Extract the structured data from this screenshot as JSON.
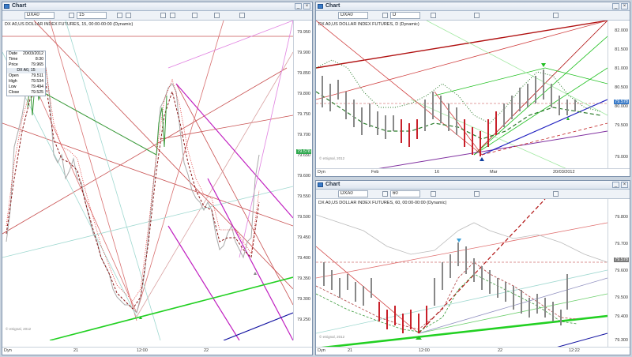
{
  "colors": {
    "accent": "#3a7bc8",
    "price_marker": "#2ea84e",
    "up_bar": "#3a9a3a",
    "down_bar": "#c8202a",
    "neutral_bar": "#888888"
  },
  "left": {
    "title": "Chart",
    "symbol": "DXA0",
    "interval": "15",
    "subtitle": "DX A0,US DOLLAR INDEX FUTURES, 15, 00:00-00:00 (Dynamic)",
    "info": [
      {
        "k": "Date",
        "v": "20/03/2012"
      },
      {
        "k": "Time",
        "v": "8:30"
      },
      {
        "k": "Price",
        "v": "79.965"
      }
    ],
    "info_header": "DX A0, 15",
    "ohlc": [
      {
        "k": "Open",
        "v": "79.511"
      },
      {
        "k": "High",
        "v": "79.534"
      },
      {
        "k": "Low",
        "v": "79.494"
      },
      {
        "k": "Close",
        "v": "79.525"
      }
    ],
    "y_ticks": [
      "79.950",
      "79.900",
      "79.850",
      "79.800",
      "79.750",
      "79.700",
      "79.650",
      "79.600",
      "79.550",
      "79.500",
      "79.450",
      "79.400",
      "79.350",
      "79.300",
      "79.250"
    ],
    "last_price": "79.578",
    "x_ticks": [
      "21",
      "12:00",
      "22"
    ],
    "dyn": "Dyn",
    "copyright": "© eSignal, 2012"
  },
  "top_right": {
    "title": "Chart",
    "symbol": "DXA0",
    "interval": "D",
    "subtitle": "DX A0,US DOLLAR INDEX FUTURES, D (Dynamic)",
    "y_ticks": [
      "82.000",
      "81.500",
      "81.000",
      "80.500",
      "80.000",
      "79.500",
      "79.000"
    ],
    "last_price": "79.578",
    "x_ticks": [
      "Feb",
      "16",
      "Mar"
    ],
    "x_date": "20/03/2012",
    "dyn": "Dyn",
    "copyright": "© eSignal, 2012"
  },
  "bottom_right": {
    "title": "Chart",
    "symbol": "DXA0",
    "interval": "60",
    "subtitle": "DX A0,US DOLLAR INDEX FUTURES, 60, 00:00-00:00 (Dynamic)",
    "y_ticks": [
      "79.800",
      "79.700",
      "79.600",
      "79.500",
      "79.400",
      "79.300"
    ],
    "last_price": "79.578",
    "x_ticks": [
      "21",
      "12:00",
      "22",
      "12:22"
    ],
    "dyn": "Dyn",
    "copyright": "© eSignal, 2012"
  }
}
